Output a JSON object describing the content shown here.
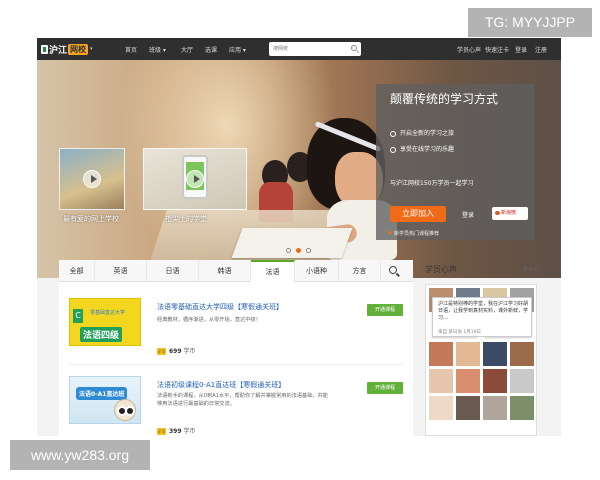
{
  "watermarks": {
    "top_right": "TG: MYYJJPP",
    "bottom_left": "www.yw283.org"
  },
  "nav": {
    "logo_text": "沪江",
    "logo_badge": "网校",
    "items": [
      "首页",
      "班级",
      "大厅",
      "选课",
      "应用"
    ],
    "search_placeholder": "搜网校",
    "right_links": [
      "学员心声",
      "快速注卡",
      "登录",
      "注册"
    ]
  },
  "hero": {
    "thumbs": [
      {
        "caption": "最有爱的网上学校"
      },
      {
        "caption": "指尖上的学堂"
      }
    ],
    "promo": {
      "title": "颠覆传统的学习方式",
      "bullets": [
        "开启全新的学习之旅",
        "享受在线学习的乐趣"
      ],
      "line3": "与沪江网校150万学员一起学习",
      "join_button": "立即加入",
      "login": "登录",
      "weibo": "新浪微",
      "note": "新学员热门课程推荐"
    }
  },
  "tabs": [
    "全部",
    "英语",
    "日语",
    "韩语",
    "法语",
    "小语种",
    "方言"
  ],
  "active_tab": "法语",
  "courses": [
    {
      "image_text": "法语四级",
      "image_sub": "零基础直达大学",
      "image_letter": "C",
      "title": "法语零基础直达大学四级【寒假通关班】",
      "desc": "经典教材，循序渐进，从零开始，直达中级！",
      "price_value": "699",
      "price_unit": "学币",
      "enroll": "开通课程"
    },
    {
      "image_text": "法语0-A1直达班",
      "title": "法语初级课程0-A1直达班【寒假通关班】",
      "desc": "法语新手的课程，从0到A1水平，帮助你了解并掌握常用的法语基础，并能够用法语进行最基础的日常交流。",
      "price_value": "399",
      "price_unit": "学币",
      "enroll": "开通课程"
    }
  ],
  "coin_label": "学币",
  "voice": {
    "title": "学员心声",
    "more": "更多",
    "bubble_text": "沪江是特别棒的学堂，我在沪江学习好胡日语，让我学到真材实料，课外新鲜，学习…",
    "bubble_meta": "来自 某日语 1月19日"
  }
}
